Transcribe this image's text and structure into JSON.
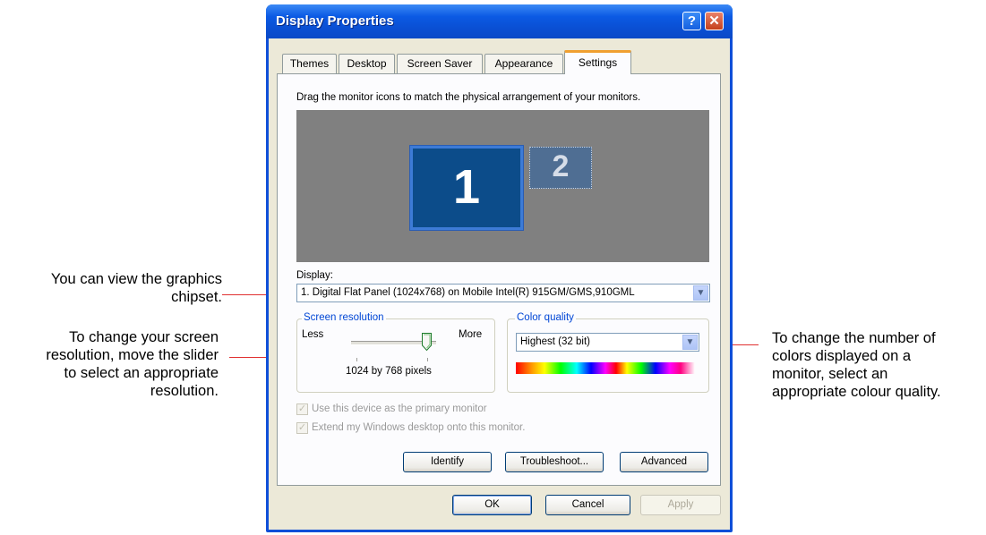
{
  "callouts": {
    "left1": [
      "You can view the graphics",
      "chipset."
    ],
    "left2": [
      "To change your screen",
      "resolution, move the slider",
      "to select an appropriate",
      "resolution."
    ],
    "right1": [
      "To change the number of",
      "colors displayed on a",
      "monitor, select an",
      "appropriate colour quality."
    ],
    "line_color": "#e03030"
  },
  "window": {
    "title": "Display Properties",
    "help_glyph": "?",
    "close_glyph": "✕"
  },
  "tabs": [
    "Themes",
    "Desktop",
    "Screen Saver",
    "Appearance",
    "Settings"
  ],
  "active_tab": "Settings",
  "settings": {
    "instruction": "Drag the monitor icons to match the physical arrangement of your monitors.",
    "monitors": [
      "1",
      "2"
    ],
    "display_label": "Display:",
    "display_value": "1. Digital Flat Panel (1024x768) on Mobile Intel(R) 915GM/GMS,910GML",
    "screen_resolution": {
      "legend": "Screen resolution",
      "less": "Less",
      "more": "More",
      "value_text": "1024 by 768 pixels",
      "slider_level": 0.85
    },
    "color_quality": {
      "legend": "Color quality",
      "selected": "Highest (32 bit)"
    },
    "checkboxes": [
      {
        "label": "Use this device as the primary monitor",
        "checked": true,
        "enabled": false
      },
      {
        "label": "Extend my Windows desktop onto this monitor.",
        "checked": true,
        "enabled": false
      }
    ],
    "buttons": {
      "identify": "Identify",
      "troubleshoot": "Troubleshoot...",
      "advanced": "Advanced"
    }
  },
  "dialog_buttons": {
    "ok": "OK",
    "cancel": "Cancel",
    "apply": "Apply"
  },
  "colors": {
    "title_bar": "#0a5ae4",
    "active_tab_accent": "#f0a030",
    "monitor_selected": "#0c4c8a",
    "face": "#ece9d8"
  }
}
